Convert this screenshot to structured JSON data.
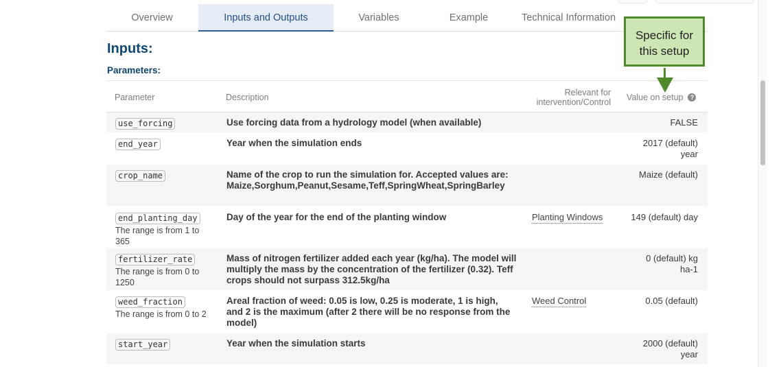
{
  "tabs": [
    {
      "label": "Overview"
    },
    {
      "label": "Inputs and Outputs"
    },
    {
      "label": "Variables"
    },
    {
      "label": "Example"
    },
    {
      "label": "Technical Information"
    }
  ],
  "section_title": "Inputs:",
  "subsection_title": "Parameters:",
  "table": {
    "headers": {
      "parameter": "Parameter",
      "description": "Description",
      "relevant_line1": "Relevant for",
      "relevant_line2": "intervention/Control",
      "value": "Value on setup"
    },
    "rows": [
      {
        "name": "use_forcing",
        "range": "",
        "description": "Use forcing data from a hydrology model (when available)",
        "relevant": "",
        "value": "FALSE"
      },
      {
        "name": "end_year",
        "range": "",
        "description": "Year when the simulation ends",
        "relevant": "",
        "value": "2017 (default) year"
      },
      {
        "name": "crop_name",
        "range": "",
        "description": "Name of the crop to run the simulation for. Accepted values are: Maize,Sorghum,Peanut,Sesame,Teff,SpringWheat,SpringBarley",
        "relevant": "",
        "value": "Maize (default)"
      },
      {
        "name": "end_planting_day",
        "range": "The range is from 1 to 365",
        "description": "Day of the year for the end of the planting window",
        "relevant": "Planting Windows",
        "value": "149 (default) day"
      },
      {
        "name": "fertilizer_rate",
        "range": "The range is from 0 to 1250",
        "description": "Mass of nitrogen fertilizer added each year (kg/ha). The model will multiply the mass by the concentration of the fertilizer (0.32). Teff crops should not surpass 312.5kg/ha",
        "relevant": "",
        "value": "0 (default) kg ha-1"
      },
      {
        "name": "weed_fraction",
        "range": "The range is from 0 to 2",
        "description": "Areal fraction of weed: 0.05 is low, 0.25 is moderate, 1 is high, and 2 is the maximum (after 2 there will be no response from the model)",
        "relevant": "Weed Control",
        "value": "0.05 (default)"
      },
      {
        "name": "start_year",
        "range": "",
        "description": "Year when the simulation starts",
        "relevant": "",
        "value": "2000 (default) year"
      }
    ]
  },
  "callout": {
    "line1": "Specific for",
    "line2": "this setup"
  },
  "icons": {
    "help": "question-circle-icon",
    "arrow": "arrow-down-icon"
  },
  "colors": {
    "accent": "#0f4772",
    "tab_active_bg": "#e6ecf6",
    "callout_bg": "#cde6b4",
    "callout_border": "#4e8a2a"
  }
}
